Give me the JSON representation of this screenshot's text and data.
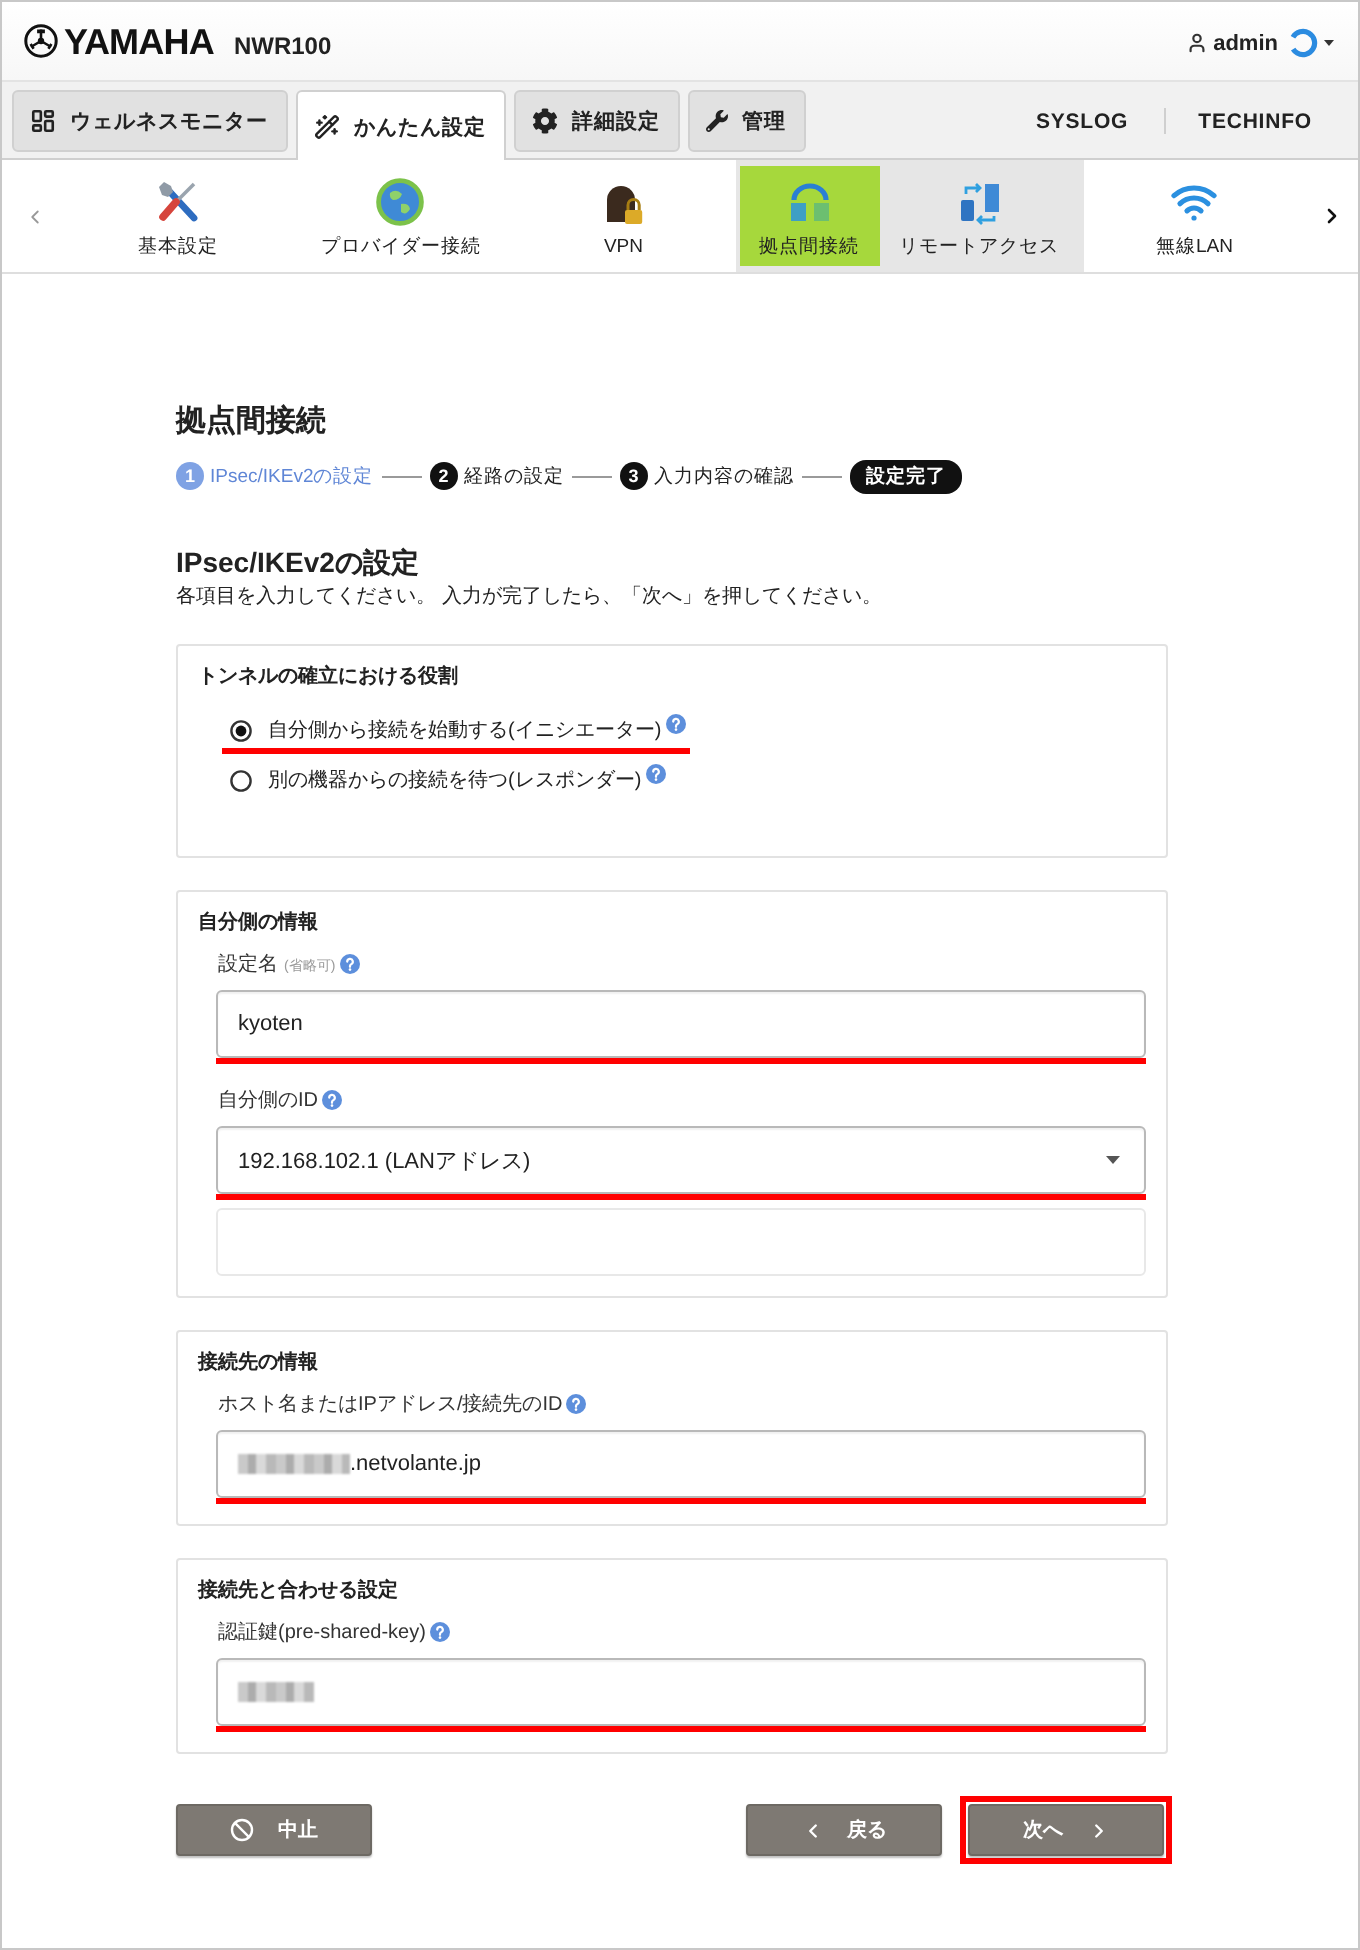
{
  "header": {
    "logo": "YAMAHA",
    "model": "NWR100",
    "user": "admin"
  },
  "main_tabs": [
    {
      "label": "ウェルネスモニター",
      "selected": false
    },
    {
      "label": "かんたん設定",
      "selected": true
    },
    {
      "label": "詳細設定",
      "selected": false
    },
    {
      "label": "管理",
      "selected": false
    }
  ],
  "header_links": [
    "SYSLOG",
    "TECHINFO"
  ],
  "sub_nav": [
    {
      "label": "基本設定",
      "selected": false,
      "shaded": false
    },
    {
      "label": "プロバイダー接続",
      "selected": false,
      "shaded": false
    },
    {
      "label": "VPN",
      "selected": false,
      "shaded": false
    },
    {
      "label": "拠点間接続",
      "selected": true,
      "shaded": true
    },
    {
      "label": "リモートアクセス",
      "selected": false,
      "shaded": true
    },
    {
      "label": "無線LAN",
      "selected": false,
      "shaded": false
    }
  ],
  "page_title": "拠点間接続",
  "steps": [
    {
      "kind": "numbered",
      "number": "1",
      "label": "IPsec/IKEv2の設定",
      "selected": true
    },
    {
      "kind": "numbered",
      "number": "2",
      "label": "経路の設定",
      "selected": false
    },
    {
      "kind": "numbered",
      "number": "3",
      "label": "入力内容の確認",
      "selected": false
    },
    {
      "kind": "final",
      "label": "設定完了",
      "selected": false
    }
  ],
  "section_title": "IPsec/IKEv2の設定",
  "instructions": "各項目を入力してください。 入力が完了したら、「次へ」を押してください。",
  "panels": [
    {
      "kind": "radios",
      "title": "トンネルの確立における役割",
      "options": [
        {
          "label": "自分側から接続を始動する(イニシエーター)",
          "selected": true,
          "help": true,
          "highlighted": true
        },
        {
          "label": "別の機器からの接続を待つ(レスポンダー)",
          "selected": false,
          "help": true,
          "highlighted": false
        }
      ]
    },
    {
      "kind": "fields",
      "title": "自分側の情報",
      "fields": [
        {
          "kind": "input",
          "label": "設定名",
          "note": "(省略可)",
          "help": true,
          "value": "kyoten",
          "highlighted": true
        },
        {
          "kind": "select",
          "label": "自分側のID",
          "help": true,
          "value": "192.168.102.1 (LANアドレス)",
          "highlighted": true
        },
        {
          "kind": "input",
          "disabled": true,
          "highlighted": false
        }
      ]
    },
    {
      "kind": "fields",
      "title": "接続先の情報",
      "fields": [
        {
          "kind": "input",
          "label": "ホスト名またはIPアドレス/接続先のID",
          "help": true,
          "blurred": true,
          "value": ".netvolante.jp",
          "highlighted": true
        }
      ]
    },
    {
      "kind": "fields",
      "title": "接続先と合わせる設定",
      "fields": [
        {
          "kind": "input",
          "label": "認証鍵(pre-shared-key)",
          "help": true,
          "blurred": true,
          "highlighted": true
        }
      ]
    }
  ],
  "buttons": [
    {
      "kind": "cancel",
      "label": "中止",
      "highlighted": false
    },
    {
      "kind": "back",
      "label": "戻る",
      "highlighted": false
    },
    {
      "kind": "next",
      "label": "次へ",
      "highlighted": true
    }
  ]
}
